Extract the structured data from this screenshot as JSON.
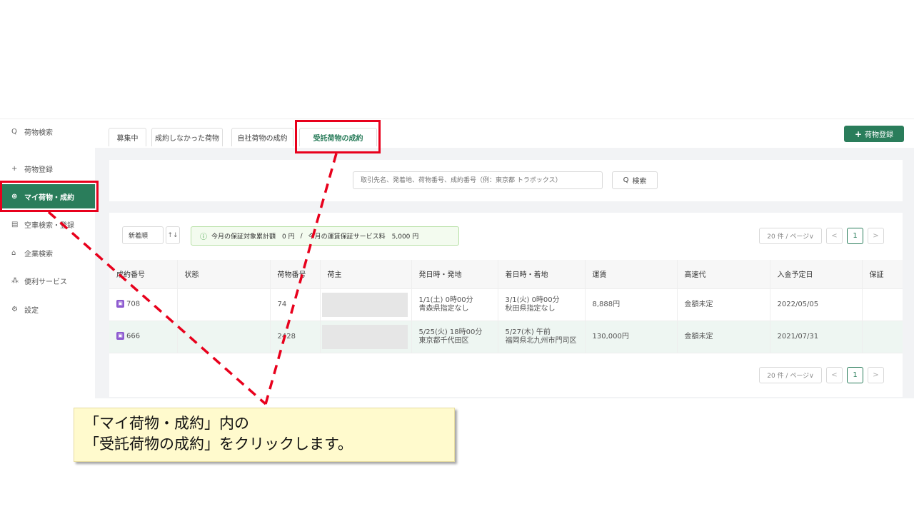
{
  "sidebar": {
    "items": [
      {
        "label": "荷物検索",
        "icon": "Q"
      },
      {
        "label": "荷物登録",
        "icon": "+"
      },
      {
        "label": "マイ荷物・成約",
        "icon": "⊛"
      },
      {
        "label": "空車検索・登録",
        "icon": "▤"
      },
      {
        "label": "企業検索",
        "icon": "⌂"
      },
      {
        "label": "便利サービス",
        "icon": "⁂"
      },
      {
        "label": "設定",
        "icon": "⚙"
      }
    ]
  },
  "tabs": [
    "募集中",
    "成約しなかった荷物",
    "自社荷物の成約",
    "受託荷物の成約"
  ],
  "add_button": "荷物登録",
  "search": {
    "placeholder": "取引先名、発着地、荷物番号、成約番号（例：東京都 トラボックス）",
    "button": "検索"
  },
  "sort": {
    "label": "新着順",
    "toggle": "↑↓"
  },
  "notice": {
    "part1": "今月の保証対象累計額　0 円",
    "separator": "/",
    "part2": "今月の運賃保証サービス料　5,000 円"
  },
  "pager": {
    "page_size": "20 件 / ページ∨",
    "prev": "<",
    "current": "1",
    "next": ">"
  },
  "table": {
    "headers": [
      "成約番号",
      "状態",
      "荷物番号",
      "荷主",
      "発日時・発地",
      "着日時・着地",
      "運賃",
      "高速代",
      "入金予定日",
      "保証"
    ],
    "rows": [
      {
        "contract_no": "708",
        "status": "",
        "cargo_no": "74",
        "shipper": "",
        "depart_time": "1/1(土) 0時00分",
        "depart_place": "青森県指定なし",
        "arrive_time": "3/1(火) 0時00分",
        "arrive_place": "秋田県指定なし",
        "fare": "8,888円",
        "toll": "金額未定",
        "payment_date": "2022/05/05",
        "guarantee": ""
      },
      {
        "contract_no": "666",
        "status": "",
        "cargo_no": "2428",
        "shipper": "",
        "depart_time": "5/25(火) 18時00分",
        "depart_place": "東京都千代田区",
        "arrive_time": "5/27(木) 午前",
        "arrive_place": "福岡県北九州市門司区",
        "fare": "130,000円",
        "toll": "金額未定",
        "payment_date": "2021/07/31",
        "guarantee": ""
      }
    ]
  },
  "callout": {
    "line1": "「マイ荷物・成約」内の",
    "line2": "「受託荷物の成約」をクリックします。"
  },
  "colors": {
    "accent": "#2a7d5b",
    "highlight": "#e8001c",
    "callout_bg": "#fffacd"
  }
}
